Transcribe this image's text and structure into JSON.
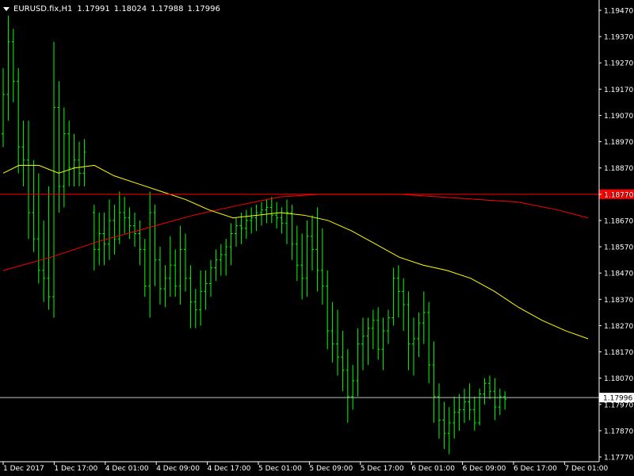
{
  "header": {
    "symbol": "EURUSD.fix,H1",
    "open": "1.17991",
    "high": "1.18024",
    "low": "1.17988",
    "close": "1.17996"
  },
  "colors": {
    "background": "#000000",
    "candles": "#00ff00",
    "ma_fast": "#ffff00",
    "ma_slow": "#ff0000",
    "axis": "#ffffff",
    "red_tag": "#ff0000",
    "bid_line": "#c0c0c0"
  },
  "icons": {
    "menu_toggle": "triangle-down-icon"
  },
  "chart_data": {
    "type": "line",
    "instrument": "EURUSD.fix",
    "timeframe": "H1",
    "y_ticks": [
      "1.19470",
      "1.19370",
      "1.19270",
      "1.19170",
      "1.19070",
      "1.18970",
      "1.18870",
      "1.18770",
      "1.18670",
      "1.18570",
      "1.18470",
      "1.18370",
      "1.18270",
      "1.18170",
      "1.18070",
      "1.17970",
      "1.17870",
      "1.17770"
    ],
    "ylim": [
      1.1777,
      1.1947
    ],
    "x_ticks": [
      "1 Dec 2017",
      "1 Dec 17:00",
      "4 Dec 01:00",
      "4 Dec 09:00",
      "4 Dec 17:00",
      "5 Dec 01:00",
      "5 Dec 09:00",
      "5 Dec 17:00",
      "6 Dec 01:00",
      "6 Dec 09:00",
      "6 Dec 17:00",
      "7 Dec 01:00"
    ],
    "horizontal_levels": [
      {
        "value": 1.1877,
        "label": "1.18770",
        "style": "red"
      },
      {
        "value": 1.17996,
        "label": "1.17996",
        "style": "bid"
      }
    ],
    "bars": [
      [
        1.19,
        1.1925,
        1.1895,
        1.1915
      ],
      [
        1.1915,
        1.1945,
        1.1905,
        1.1935
      ],
      [
        1.1935,
        1.194,
        1.1912,
        1.192
      ],
      [
        1.192,
        1.1925,
        1.1885,
        1.1895
      ],
      [
        1.1895,
        1.1905,
        1.188,
        1.189
      ],
      [
        1.189,
        1.1905,
        1.186,
        1.187
      ],
      [
        1.187,
        1.189,
        1.1855,
        1.186
      ],
      [
        1.186,
        1.1885,
        1.1843,
        1.1848
      ],
      [
        1.1848,
        1.1867,
        1.1836,
        1.1845
      ],
      [
        1.1845,
        1.188,
        1.1833,
        1.1838
      ],
      [
        1.1838,
        1.1935,
        1.183,
        1.191
      ],
      [
        1.191,
        1.192,
        1.187,
        1.188
      ],
      [
        1.188,
        1.191,
        1.1872,
        1.19
      ],
      [
        1.19,
        1.1905,
        1.188,
        1.1887
      ],
      [
        1.1887,
        1.19,
        1.188,
        1.189
      ],
      [
        1.189,
        1.1897,
        1.188,
        1.1885
      ],
      [
        1.1885,
        1.1898,
        1.188,
        1.1893
      ],
      [
        1.187,
        1.1873,
        1.1848,
        1.1856
      ],
      [
        1.1856,
        1.187,
        1.185,
        1.1862
      ],
      [
        1.1862,
        1.187,
        1.185,
        1.1858
      ],
      [
        1.1858,
        1.1875,
        1.1852,
        1.1867
      ],
      [
        1.1867,
        1.1873,
        1.1854,
        1.186
      ],
      [
        1.186,
        1.1878,
        1.1858,
        1.187
      ],
      [
        1.187,
        1.1876,
        1.1862,
        1.1868
      ],
      [
        1.1868,
        1.1872,
        1.186,
        1.1865
      ],
      [
        1.1865,
        1.187,
        1.1857,
        1.1862
      ],
      [
        1.1862,
        1.1867,
        1.185,
        1.1856
      ],
      [
        1.1856,
        1.186,
        1.1838,
        1.1842
      ],
      [
        1.1842,
        1.1878,
        1.183,
        1.187
      ],
      [
        1.187,
        1.1873,
        1.1842,
        1.1852
      ],
      [
        1.1852,
        1.1857,
        1.1835,
        1.1841
      ],
      [
        1.1841,
        1.185,
        1.1834,
        1.1845
      ],
      [
        1.1845,
        1.1861,
        1.1838,
        1.185
      ],
      [
        1.185,
        1.1856,
        1.1838,
        1.1842
      ],
      [
        1.1842,
        1.1865,
        1.1835,
        1.1856
      ],
      [
        1.1856,
        1.1862,
        1.184,
        1.1845
      ],
      [
        1.1845,
        1.185,
        1.1826,
        1.1836
      ],
      [
        1.1836,
        1.1841,
        1.1826,
        1.1833
      ],
      [
        1.1833,
        1.1848,
        1.1827,
        1.184
      ],
      [
        1.184,
        1.1848,
        1.1833,
        1.1843
      ],
      [
        1.1843,
        1.1852,
        1.1838,
        1.1849
      ],
      [
        1.1849,
        1.1856,
        1.1844,
        1.1852
      ],
      [
        1.1852,
        1.1858,
        1.1846,
        1.1854
      ],
      [
        1.1854,
        1.186,
        1.1846,
        1.1857
      ],
      [
        1.1857,
        1.1866,
        1.185,
        1.1862
      ],
      [
        1.1862,
        1.1868,
        1.1857,
        1.1865
      ],
      [
        1.1865,
        1.187,
        1.1858,
        1.1864
      ],
      [
        1.1864,
        1.1871,
        1.186,
        1.1867
      ],
      [
        1.1867,
        1.1872,
        1.1862,
        1.1868
      ],
      [
        1.1868,
        1.1873,
        1.1863,
        1.187
      ],
      [
        1.187,
        1.1874,
        1.1865,
        1.1871
      ],
      [
        1.1871,
        1.1875,
        1.1866,
        1.1872
      ],
      [
        1.1872,
        1.1876,
        1.1866,
        1.1869
      ],
      [
        1.1869,
        1.1874,
        1.1864,
        1.1868
      ],
      [
        1.1868,
        1.1872,
        1.1862,
        1.1866
      ],
      [
        1.1866,
        1.1875,
        1.1858,
        1.187
      ],
      [
        1.187,
        1.1873,
        1.1852,
        1.1858
      ],
      [
        1.1858,
        1.1865,
        1.1844,
        1.185
      ],
      [
        1.185,
        1.1862,
        1.1837,
        1.1845
      ],
      [
        1.1845,
        1.1867,
        1.1838,
        1.1861
      ],
      [
        1.1861,
        1.1869,
        1.1848,
        1.1856
      ],
      [
        1.1856,
        1.1872,
        1.184,
        1.1848
      ],
      [
        1.1848,
        1.1864,
        1.1835,
        1.1842
      ],
      [
        1.1842,
        1.1848,
        1.1818,
        1.1825
      ],
      [
        1.1825,
        1.1836,
        1.1813,
        1.182
      ],
      [
        1.182,
        1.1833,
        1.1808,
        1.1815
      ],
      [
        1.1815,
        1.1825,
        1.1802,
        1.181
      ],
      [
        1.181,
        1.1818,
        1.179,
        1.18
      ],
      [
        1.18,
        1.1812,
        1.1795,
        1.1806
      ],
      [
        1.1806,
        1.1826,
        1.18,
        1.182
      ],
      [
        1.182,
        1.183,
        1.181,
        1.1823
      ],
      [
        1.1823,
        1.183,
        1.1812,
        1.1826
      ],
      [
        1.1826,
        1.1833,
        1.1818,
        1.1829
      ],
      [
        1.1829,
        1.1834,
        1.1814,
        1.1818
      ],
      [
        1.1818,
        1.183,
        1.181,
        1.1825
      ],
      [
        1.1825,
        1.1833,
        1.182,
        1.183
      ],
      [
        1.183,
        1.1849,
        1.1827,
        1.1845
      ],
      [
        1.1845,
        1.185,
        1.183,
        1.184
      ],
      [
        1.184,
        1.1845,
        1.1825,
        1.1835
      ],
      [
        1.1835,
        1.184,
        1.181,
        1.182
      ],
      [
        1.182,
        1.183,
        1.1808,
        1.1822
      ],
      [
        1.1822,
        1.1832,
        1.1815,
        1.1828
      ],
      [
        1.1828,
        1.184,
        1.182,
        1.1832
      ],
      [
        1.1832,
        1.1836,
        1.1805,
        1.1812
      ],
      [
        1.1812,
        1.1821,
        1.179,
        1.18
      ],
      [
        1.18,
        1.1805,
        1.1784,
        1.1791
      ],
      [
        1.1791,
        1.1798,
        1.178,
        1.1786
      ],
      [
        1.1786,
        1.1796,
        1.1778,
        1.179
      ],
      [
        1.179,
        1.18,
        1.1784,
        1.1794
      ],
      [
        1.1794,
        1.1801,
        1.1787,
        1.1795
      ],
      [
        1.1795,
        1.1803,
        1.179,
        1.1798
      ],
      [
        1.1798,
        1.1805,
        1.1791,
        1.1795
      ],
      [
        1.1795,
        1.18,
        1.1787,
        1.179
      ],
      [
        1.179,
        1.1803,
        1.1789,
        1.1801
      ],
      [
        1.1801,
        1.1807,
        1.1797,
        1.1805
      ],
      [
        1.1805,
        1.1808,
        1.1799,
        1.1802
      ],
      [
        1.1802,
        1.1807,
        1.1791,
        1.1796
      ],
      [
        1.1796,
        1.1803,
        1.1793,
        1.18
      ],
      [
        1.18,
        1.1802,
        1.1795,
        1.1799
      ]
    ],
    "ma_fast": [
      [
        0,
        1.1885
      ],
      [
        20,
        1.1888
      ],
      [
        45,
        1.1888
      ],
      [
        70,
        1.1885
      ],
      [
        90,
        1.1887
      ],
      [
        115,
        1.1888
      ],
      [
        140,
        1.1884
      ],
      [
        170,
        1.1881
      ],
      [
        200,
        1.1878
      ],
      [
        230,
        1.1875
      ],
      [
        260,
        1.1871
      ],
      [
        290,
        1.1868
      ],
      [
        320,
        1.1869
      ],
      [
        350,
        1.187
      ],
      [
        380,
        1.1869
      ],
      [
        410,
        1.1867
      ],
      [
        440,
        1.1863
      ],
      [
        470,
        1.1858
      ],
      [
        500,
        1.1853
      ],
      [
        530,
        1.185
      ],
      [
        560,
        1.1848
      ],
      [
        590,
        1.1845
      ],
      [
        620,
        1.184
      ],
      [
        650,
        1.1834
      ],
      [
        680,
        1.1829
      ],
      [
        710,
        1.1825
      ],
      [
        738,
        1.1822
      ]
    ],
    "ma_slow": [
      [
        0,
        1.1848
      ],
      [
        60,
        1.1853
      ],
      [
        120,
        1.1859
      ],
      [
        180,
        1.1864
      ],
      [
        240,
        1.1869
      ],
      [
        300,
        1.1873
      ],
      [
        350,
        1.1876
      ],
      [
        400,
        1.1877
      ],
      [
        450,
        1.1877
      ],
      [
        500,
        1.1877
      ],
      [
        550,
        1.1876
      ],
      [
        600,
        1.1875
      ],
      [
        650,
        1.1874
      ],
      [
        700,
        1.1871
      ],
      [
        738,
        1.1868
      ]
    ]
  }
}
